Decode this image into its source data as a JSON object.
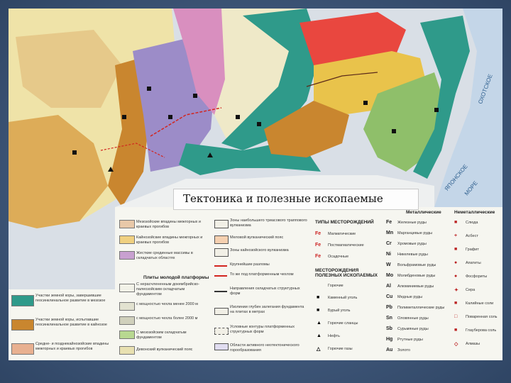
{
  "title": "Тектоника и полезные ископаемые",
  "colors": {
    "teal": "#2f9a8a",
    "violet": "#9c8cc8",
    "pink": "#d98fbf",
    "red": "#e9473f",
    "orange": "#c9862f",
    "yellow": "#e9c34b",
    "green": "#8fbf6a",
    "paleyellow": "#e8dfa0",
    "sea": "#d7e4ef"
  },
  "legend": {
    "platform_heading": "Плиты молодой платформы",
    "deposit_types_heading": "ТИПЫ МЕСТОРОЖДЕНИЙ",
    "minerals_heading": "МЕСТОРОЖДЕНИЯ ПОЛЕЗНЫХ ИСКОПАЕМЫХ",
    "fuel_heading": "Горючие",
    "metal_heading": "Металлические",
    "nonmetal_heading": "Неметаллические",
    "deposit_types": [
      {
        "sym": "Fe",
        "label": "Магматические"
      },
      {
        "sym": "Fe",
        "label": "Постмагматические"
      },
      {
        "sym": "Fe",
        "label": "Осадочные"
      }
    ],
    "fuels": [
      {
        "sym": "■",
        "label": "Каменный уголь"
      },
      {
        "sym": "■",
        "label": "Бурый уголь"
      },
      {
        "sym": "▲",
        "label": "Горючие сланцы"
      },
      {
        "sym": "▲",
        "label": "Нефть"
      },
      {
        "sym": "△",
        "label": "Горючие газы"
      }
    ],
    "metals": [
      {
        "sym": "Fe",
        "label": "Железные руды"
      },
      {
        "sym": "Mn",
        "label": "Марганцевые руды"
      },
      {
        "sym": "Cr",
        "label": "Хромовые руды"
      },
      {
        "sym": "Ni",
        "label": "Никелевые руды"
      },
      {
        "sym": "W",
        "label": "Вольфрамовые руды"
      },
      {
        "sym": "Mo",
        "label": "Молибденовые руды"
      },
      {
        "sym": "Al",
        "label": "Алюминиевые руды"
      },
      {
        "sym": "Cu",
        "label": "Медные руды"
      },
      {
        "sym": "Pb",
        "label": "Полиметаллические руды"
      },
      {
        "sym": "Sn",
        "label": "Оловянные руды"
      },
      {
        "sym": "Sb",
        "label": "Сурьмяные руды"
      },
      {
        "sym": "Hg",
        "label": "Ртутные руды"
      },
      {
        "sym": "Au",
        "label": "Золото"
      }
    ],
    "nonmetals": [
      {
        "sym": "■",
        "label": "Слюда"
      },
      {
        "sym": "+",
        "label": "Асбест"
      },
      {
        "sym": "■",
        "label": "Графит"
      },
      {
        "sym": "●",
        "label": "Апатиты"
      },
      {
        "sym": "●",
        "label": "Фосфориты"
      },
      {
        "sym": "✦",
        "label": "Сера"
      },
      {
        "sym": "■",
        "label": "Калийные соли"
      },
      {
        "sym": "□",
        "label": "Поваренная соль"
      },
      {
        "sym": "■",
        "label": "Глауберова соль"
      },
      {
        "sym": "◇",
        "label": "Алмазы"
      }
    ],
    "tectonic_left": [
      {
        "color": "#e8c8a8",
        "label": "Мезозойские впадины межгорных и краевых прогибов"
      },
      {
        "color": "#f0d080",
        "label": "Кайнозойские впадины межгорных и краевых прогибов"
      },
      {
        "color": "#c8a0d0",
        "label": "Жесткие срединные массивы в складчатых областях"
      },
      {
        "color": "#2f9a8a",
        "label": "Участки земной коры, завершившие геосинклинальное развитие в мезозое"
      },
      {
        "color": "#c9862f",
        "label": "Участки земной коры, испытавшие геосинклинальное развитие в кайнозое"
      },
      {
        "color": "#e8b090",
        "label": "Средне- и позднекайнозойские впадины межгорных и краевых прогибов"
      }
    ],
    "platform_items": [
      {
        "color": "#f2f2e8",
        "label": "С нерасчлененным докембрийско-палеозойским складчатым фундаментом"
      },
      {
        "color": "#e2e2d0",
        "label": "с мощностью чехла менее 2000 м"
      },
      {
        "color": "#d0d0bc",
        "label": "с мощностью чехла более 2000 м"
      },
      {
        "color": "#b8d890",
        "label": "С мезозойским складчатым фундаментом"
      },
      {
        "color": "#e8e0b0",
        "label": "Девонский вулканический пояс"
      }
    ],
    "middle_items": [
      {
        "label": "Зоны наибольшего триасового траппового вулканизма"
      },
      {
        "label": "Меловой вулканический пояс"
      },
      {
        "label": "Зоны кайнозойского вулканизма"
      },
      {
        "label": "Крупнейшие разломы"
      },
      {
        "label": "То же под платформенным чехлом"
      },
      {
        "label": "Направления складчатых структурных форм"
      },
      {
        "label": "Изолинии глубин залегания фундамента на плитах в метрах"
      },
      {
        "label": "Условные контуры платформенных структурных форм"
      },
      {
        "label": "Области активного неотектонического горообразования"
      }
    ]
  },
  "map_labels": {
    "sea_right_1": "ЯПОНСКОЕ",
    "sea_right_2": "МОРЕ",
    "sea_right_3": "ОХОТСКОЕ"
  }
}
